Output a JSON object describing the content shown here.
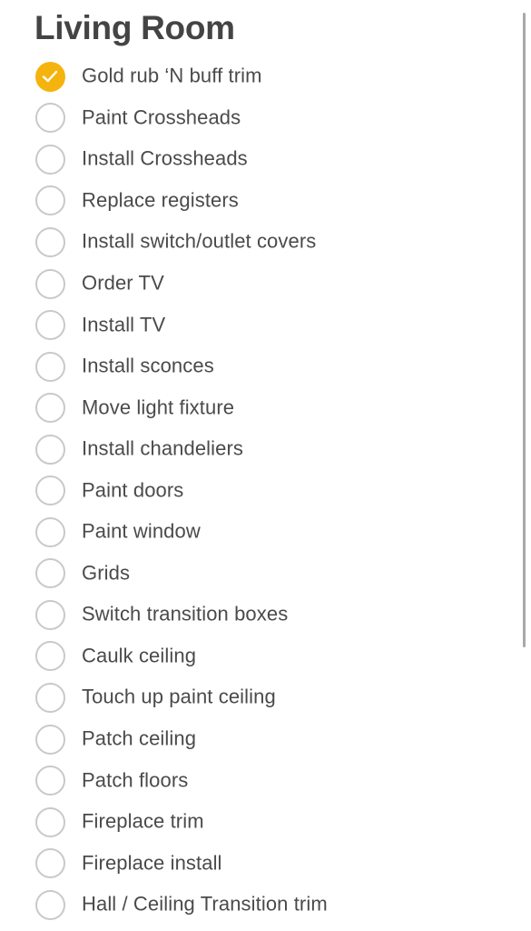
{
  "header": {
    "title": "Living Room"
  },
  "colors": {
    "accent_checked": "#F5B30E",
    "unchecked_stroke": "#C9C9C9",
    "text": "#4A4A4A",
    "title": "#444444"
  },
  "icons": {
    "checked": "checkmark-circle-icon",
    "unchecked": "empty-circle-icon"
  },
  "tasks": [
    {
      "label": "Gold rub ‘N buff trim",
      "checked": true
    },
    {
      "label": "Paint Crossheads",
      "checked": false
    },
    {
      "label": "Install Crossheads",
      "checked": false
    },
    {
      "label": "Replace registers",
      "checked": false
    },
    {
      "label": "Install switch/outlet covers",
      "checked": false
    },
    {
      "label": "Order TV",
      "checked": false
    },
    {
      "label": "Install TV",
      "checked": false
    },
    {
      "label": "Install sconces",
      "checked": false
    },
    {
      "label": "Move light fixture",
      "checked": false
    },
    {
      "label": "Install chandeliers",
      "checked": false
    },
    {
      "label": "Paint doors",
      "checked": false
    },
    {
      "label": "Paint window",
      "checked": false
    },
    {
      "label": "Grids",
      "checked": false
    },
    {
      "label": "Switch transition boxes",
      "checked": false
    },
    {
      "label": "Caulk ceiling",
      "checked": false
    },
    {
      "label": "Touch up paint ceiling",
      "checked": false
    },
    {
      "label": "Patch ceiling",
      "checked": false
    },
    {
      "label": "Patch floors",
      "checked": false
    },
    {
      "label": "Fireplace trim",
      "checked": false
    },
    {
      "label": "Fireplace install",
      "checked": false
    },
    {
      "label": "Hall / Ceiling Transition trim",
      "checked": false
    }
  ]
}
